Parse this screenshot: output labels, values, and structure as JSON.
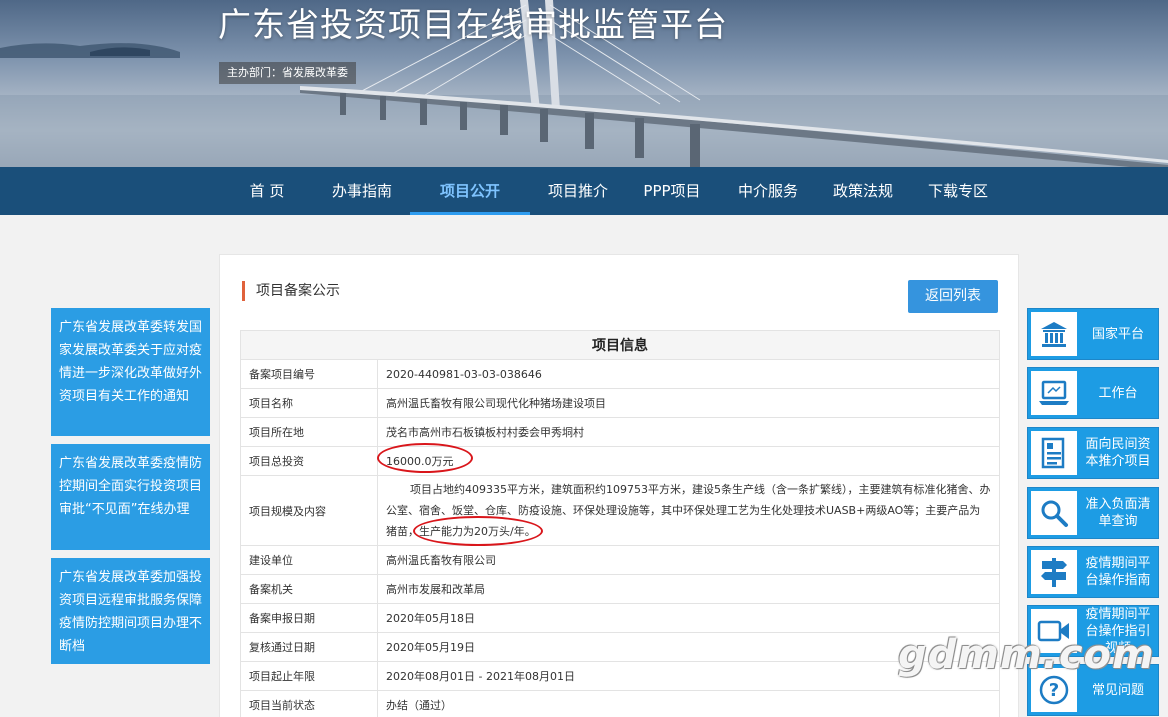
{
  "header": {
    "site_title": "广东省投资项目在线审批监管平台",
    "sponsor": "主办部门：省发展改革委"
  },
  "nav": {
    "items": [
      {
        "label": "首 页"
      },
      {
        "label": "办事指南"
      },
      {
        "label": "项目公开"
      },
      {
        "label": "项目推介"
      },
      {
        "label": "PPP项目"
      },
      {
        "label": "中介服务"
      },
      {
        "label": "政策法规"
      },
      {
        "label": "下载专区"
      }
    ],
    "active": "项目公开"
  },
  "main": {
    "section_title": "项目备案公示",
    "back_button": "返回列表",
    "table_title": "项目信息",
    "rows": [
      {
        "label": "备案项目编号",
        "value": "2020-440981-03-03-038646"
      },
      {
        "label": "项目名称",
        "value": "高州温氏畜牧有限公司现代化种猪场建设项目"
      },
      {
        "label": "项目所在地",
        "value": "茂名市高州市石板镇板村村委会甲秀垌村"
      },
      {
        "label": "项目总投资",
        "value": "16000.0万元"
      },
      {
        "label": "项目规模及内容",
        "value": "项目占地约409335平方米，建筑面积约109753平方米，建设5条生产线（含一条扩繁线），主要建筑有标准化猪舍、办公室、宿舍、饭堂、仓库、防疫设施、环保处理设施等，其中环保处理工艺为生化处理技术UASB+两级AO等；主要产品为猪苗，",
        "value_tail": "生产能力为20万头/年。"
      },
      {
        "label": "建设单位",
        "value": "高州温氏畜牧有限公司"
      },
      {
        "label": "备案机关",
        "value": "高州市发展和改革局"
      },
      {
        "label": "备案申报日期",
        "value": "2020年05月18日"
      },
      {
        "label": "复核通过日期",
        "value": "2020年05月19日"
      },
      {
        "label": "项目起止年限",
        "value": "2020年08月01日 - 2021年08月01日"
      },
      {
        "label": "项目当前状态",
        "value": "办结（通过）"
      }
    ]
  },
  "left_news": [
    {
      "text": "广东省发展改革委转发国家发展改革委关于应对疫情进一步深化改革做好外资项目有关工作的通知"
    },
    {
      "text": "广东省发展改革委疫情防控期间全面实行投资项目审批“不见面”在线办理"
    },
    {
      "text": "广东省发展改革委加强投资项目远程审批服务保障疫情防控期间项目办理不断档"
    }
  ],
  "right_sidebar": [
    {
      "label": "国家平台",
      "icon": "government-building-icon"
    },
    {
      "label": "工作台",
      "icon": "laptop-icon"
    },
    {
      "label": "面向民间资本推介项目",
      "icon": "document-list-icon"
    },
    {
      "label": "准入负面清单查询",
      "icon": "search-icon"
    },
    {
      "label": "疫情期间平台操作指南",
      "icon": "signpost-icon"
    },
    {
      "label": "疫情期间平台操作指引视频",
      "icon": "video-camera-icon"
    },
    {
      "label": "常见问题",
      "icon": "question-icon"
    }
  ],
  "watermark": "gdmm.com",
  "colors": {
    "nav_bg": "#1a4f7a",
    "accent_blue": "#2b9de4",
    "annotation_red": "#d9161b",
    "section_bar": "#e0623c"
  }
}
